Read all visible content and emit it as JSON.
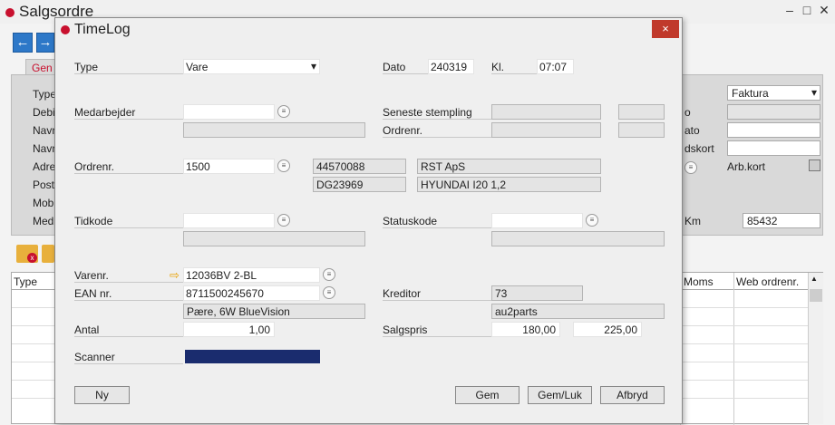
{
  "background": {
    "title": "Salgsordre",
    "tab_label": "Gen",
    "left_labels": [
      "Type",
      "Debi",
      "Navn",
      "Navn",
      "Adre",
      "Post",
      "Mobi",
      "Medi"
    ],
    "right_labels": {
      "lbl_o": "o",
      "lbl_ato": "ato",
      "lbl_dskort": "dskort",
      "arbkort": "Arb.kort",
      "km": "Km"
    },
    "faktura_select": "Faktura",
    "km_value": "85432",
    "table_headers": {
      "type": "Type",
      "moms": "Moms",
      "web_ordrenr": "Web ordrenr."
    }
  },
  "dialog": {
    "title": "TimeLog",
    "close": "×",
    "type_label": "Type",
    "type_value": "Vare",
    "dato_label": "Dato",
    "dato_value": "240319",
    "kl_label": "Kl.",
    "kl_value": "07:07",
    "medarbejder_label": "Medarbejder",
    "medarbejder_value": "",
    "seneste_stempling_label": "Seneste stempling",
    "ordrenr_label_right": "Ordrenr.",
    "ordrenr_label": "Ordrenr.",
    "ordrenr_value": "1500",
    "ordre_info": {
      "field1": "44570088",
      "field2": "RST ApS",
      "field3": "DG23969",
      "field4": "HYUNDAI I20 1,2"
    },
    "tidkode_label": "Tidkode",
    "tidkode_value": "",
    "statuskode_label": "Statuskode",
    "statuskode_value": "",
    "varenr_label": "Varenr.",
    "varenr_value": "12036BV 2-BL",
    "ean_label": "EAN nr.",
    "ean_value": "8711500245670",
    "vare_desc": "Pære, 6W BlueVision",
    "kreditor_label": "Kreditor",
    "kreditor_nr": "73",
    "kreditor_name": "au2parts",
    "antal_label": "Antal",
    "antal_value": "1,00",
    "salgspris_label": "Salgspris",
    "salgspris_value1": "180,00",
    "salgspris_value2": "225,00",
    "scanner_label": "Scanner",
    "buttons": {
      "ny": "Ny",
      "gem": "Gem",
      "gem_luk": "Gem/Luk",
      "afbryd": "Afbryd"
    }
  },
  "colors": {
    "accent_red": "#c8102e",
    "scanner_bar": "#1a2c6e",
    "nav_blue": "#2d78c8"
  }
}
